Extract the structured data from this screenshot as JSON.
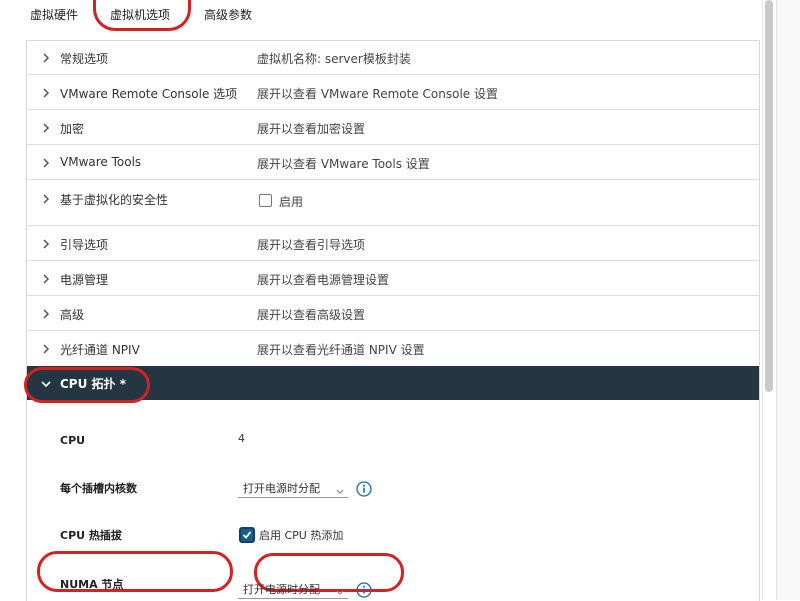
{
  "tabs": [
    {
      "label": "虚拟硬件"
    },
    {
      "label": "虚拟机选项"
    },
    {
      "label": "高级参数"
    }
  ],
  "rows": [
    {
      "label": "常规选项",
      "value": "虚拟机名称: server模板封装"
    },
    {
      "label": "VMware Remote Console 选项",
      "value": "展开以查看 VMware Remote Console 设置"
    },
    {
      "label": "加密",
      "value": "展开以查看加密设置"
    },
    {
      "label": "VMware Tools",
      "value": "展开以查看 VMware Tools 设置"
    },
    {
      "label": "基于虚拟化的安全性",
      "value": "启用"
    },
    {
      "label": "引导选项",
      "value": "展开以查看引导选项"
    },
    {
      "label": "电源管理",
      "value": "展开以查看电源管理设置"
    },
    {
      "label": "高级",
      "value": "展开以查看高级设置"
    },
    {
      "label": "光纤通道 NPIV",
      "value": "展开以查看光纤通道 NPIV 设置"
    }
  ],
  "cpu_topology": {
    "header": "CPU 拓扑 *",
    "cpu_label": "CPU",
    "cpu_value": "4",
    "cores_label": "每个插槽内核数",
    "cores_select": "打开电源时分配",
    "hotplug_label": "CPU 热插拔",
    "hotplug_checkbox_label": "启用 CPU 热添加",
    "hotplug_checked": true,
    "numa_label": "NUMA 节点",
    "numa_select": "打开电源时分配"
  },
  "icons": {
    "row_chevron": "chevron-right-icon",
    "expanded_chevron": "chevron-down-icon",
    "info": "info-icon",
    "dropdown": "chevron-down-icon"
  },
  "colors": {
    "header_bg": "#243642",
    "annotation": "#d42121",
    "checkbox_checked": "#1a5f8a",
    "info_icon": "#1a6aa8"
  }
}
